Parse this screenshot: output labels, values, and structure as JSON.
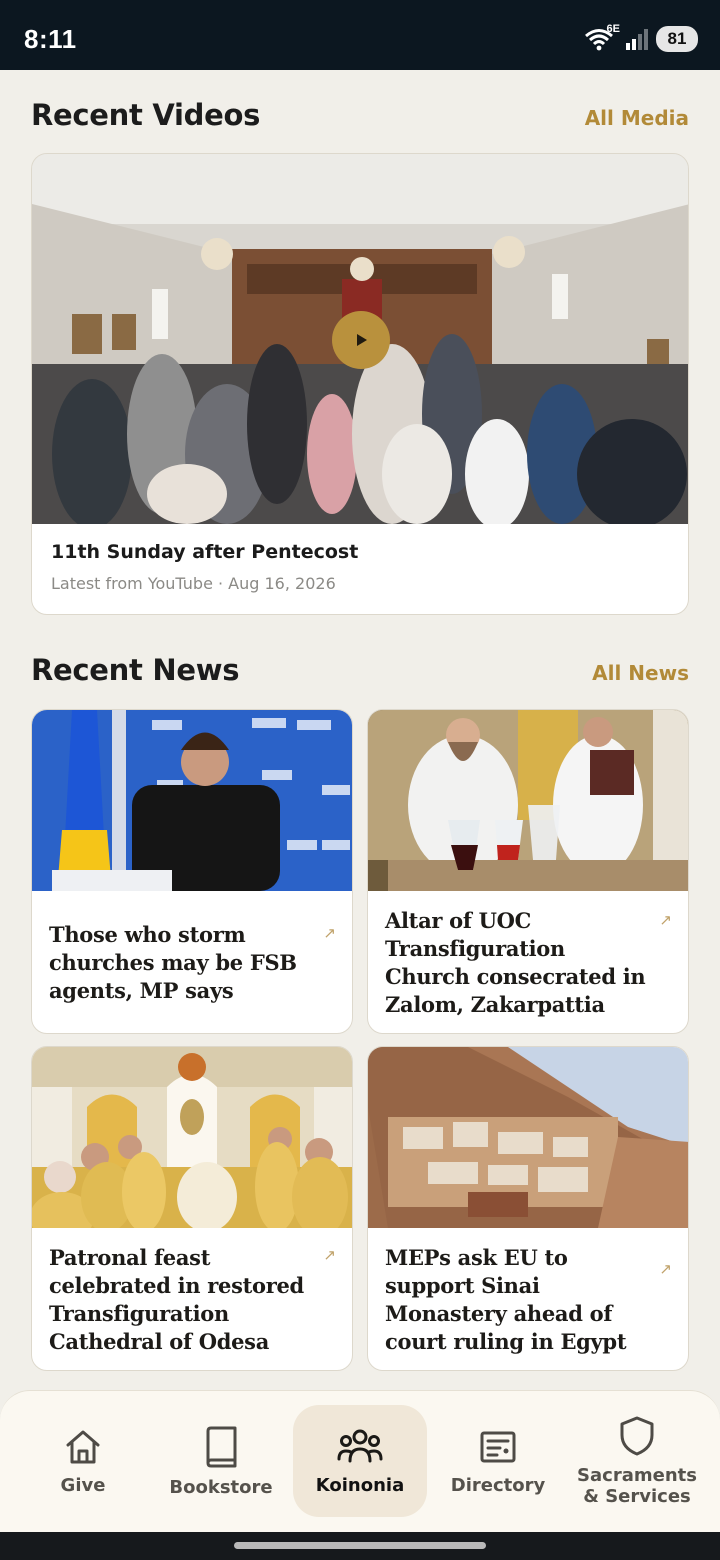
{
  "status_bar": {
    "time": "8:11",
    "network_label": "6E",
    "battery": "81"
  },
  "recent_videos": {
    "title": "Recent Videos",
    "link": "All Media",
    "video": {
      "title": "11th Sunday after Pentecost",
      "subtitle": "Latest from YouTube · Aug 16, 2026"
    }
  },
  "recent_news": {
    "title": "Recent News",
    "link": "All News",
    "items": [
      {
        "title": "Those who storm churches may be FSB agents, MP says"
      },
      {
        "title": "Altar of UOC Transfiguration Church consecrated in Zalom, Zakarpattia"
      },
      {
        "title": "Patronal feast celebrated in restored Transfiguration Cathedral of Odesa"
      },
      {
        "title": "MEPs ask EU to support Sinai Monastery ahead of court ruling in Egypt"
      }
    ],
    "arrow_glyph": "↗"
  },
  "bottom_nav": {
    "items": [
      {
        "label": "Give",
        "icon": "home-icon"
      },
      {
        "label": "Bookstore",
        "icon": "book-icon"
      },
      {
        "label": "Koinonia",
        "icon": "people-icon",
        "active": true
      },
      {
        "label": "Directory",
        "icon": "directory-icon"
      },
      {
        "label": "Sacraments & Services",
        "icon": "shield-icon"
      }
    ]
  },
  "colors": {
    "accent": "#b28a38",
    "background": "#f1efe9",
    "status_bar": "#0c1720"
  }
}
